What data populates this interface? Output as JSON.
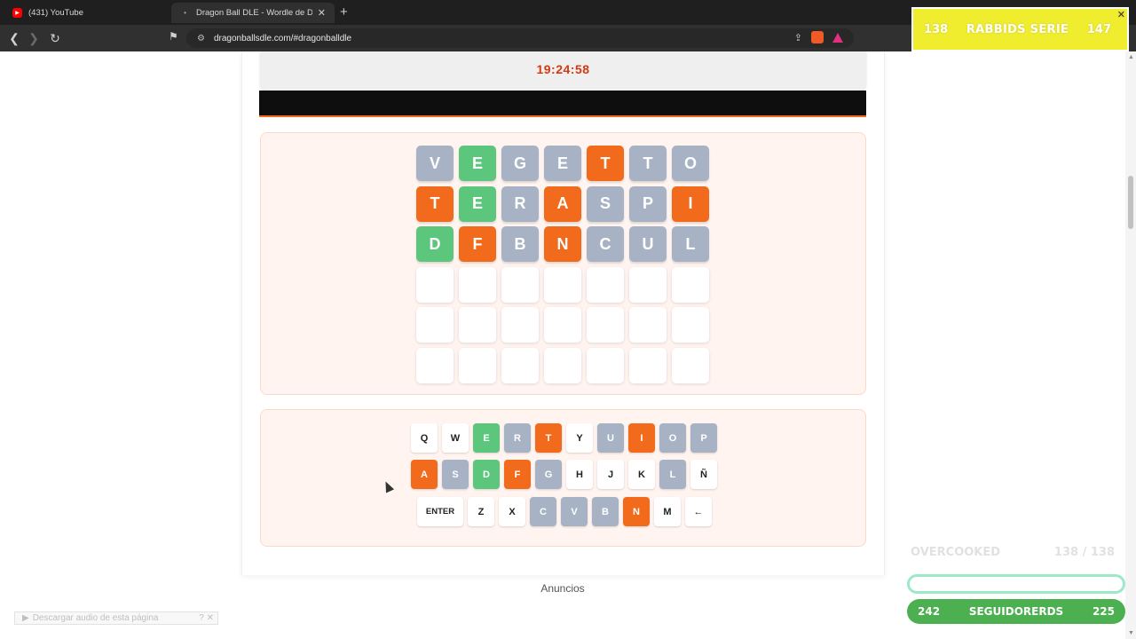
{
  "browser": {
    "tabs": [
      {
        "label": "(431) YouTube",
        "active": false
      },
      {
        "label": "Dragon Ball DLE - Wordle de Dra",
        "active": true
      }
    ],
    "url": "dragonballsdle.com/#dragonballdle"
  },
  "game": {
    "timer": "19:24:58",
    "grid": [
      [
        {
          "l": "V",
          "s": "gray"
        },
        {
          "l": "E",
          "s": "green"
        },
        {
          "l": "G",
          "s": "gray"
        },
        {
          "l": "E",
          "s": "gray"
        },
        {
          "l": "T",
          "s": "orange"
        },
        {
          "l": "T",
          "s": "gray"
        },
        {
          "l": "O",
          "s": "gray"
        }
      ],
      [
        {
          "l": "T",
          "s": "orange"
        },
        {
          "l": "E",
          "s": "green"
        },
        {
          "l": "R",
          "s": "gray"
        },
        {
          "l": "A",
          "s": "orange"
        },
        {
          "l": "S",
          "s": "gray"
        },
        {
          "l": "P",
          "s": "gray"
        },
        {
          "l": "I",
          "s": "orange"
        }
      ],
      [
        {
          "l": "D",
          "s": "green"
        },
        {
          "l": "F",
          "s": "orange"
        },
        {
          "l": "B",
          "s": "gray"
        },
        {
          "l": "N",
          "s": "orange"
        },
        {
          "l": "C",
          "s": "gray"
        },
        {
          "l": "U",
          "s": "gray"
        },
        {
          "l": "L",
          "s": "gray"
        }
      ],
      [
        {
          "l": "",
          "s": "empty"
        },
        {
          "l": "",
          "s": "empty"
        },
        {
          "l": "",
          "s": "empty"
        },
        {
          "l": "",
          "s": "empty"
        },
        {
          "l": "",
          "s": "empty"
        },
        {
          "l": "",
          "s": "empty"
        },
        {
          "l": "",
          "s": "empty"
        }
      ],
      [
        {
          "l": "",
          "s": "empty"
        },
        {
          "l": "",
          "s": "empty"
        },
        {
          "l": "",
          "s": "empty"
        },
        {
          "l": "",
          "s": "empty"
        },
        {
          "l": "",
          "s": "empty"
        },
        {
          "l": "",
          "s": "empty"
        },
        {
          "l": "",
          "s": "empty"
        }
      ],
      [
        {
          "l": "",
          "s": "empty"
        },
        {
          "l": "",
          "s": "empty"
        },
        {
          "l": "",
          "s": "empty"
        },
        {
          "l": "",
          "s": "empty"
        },
        {
          "l": "",
          "s": "empty"
        },
        {
          "l": "",
          "s": "empty"
        },
        {
          "l": "",
          "s": "empty"
        }
      ]
    ],
    "keyboard": [
      [
        {
          "k": "Q",
          "s": "white"
        },
        {
          "k": "W",
          "s": "white"
        },
        {
          "k": "E",
          "s": "green"
        },
        {
          "k": "R",
          "s": "gray"
        },
        {
          "k": "T",
          "s": "orange"
        },
        {
          "k": "Y",
          "s": "white"
        },
        {
          "k": "U",
          "s": "gray"
        },
        {
          "k": "I",
          "s": "orange"
        },
        {
          "k": "O",
          "s": "gray"
        },
        {
          "k": "P",
          "s": "gray"
        }
      ],
      [
        {
          "k": "A",
          "s": "orange"
        },
        {
          "k": "S",
          "s": "gray"
        },
        {
          "k": "D",
          "s": "green"
        },
        {
          "k": "F",
          "s": "orange"
        },
        {
          "k": "G",
          "s": "gray"
        },
        {
          "k": "H",
          "s": "white"
        },
        {
          "k": "J",
          "s": "white"
        },
        {
          "k": "K",
          "s": "white"
        },
        {
          "k": "L",
          "s": "gray"
        },
        {
          "k": "Ñ",
          "s": "white"
        }
      ],
      [
        {
          "k": "ENTER",
          "s": "white"
        },
        {
          "k": "Z",
          "s": "white"
        },
        {
          "k": "X",
          "s": "white"
        },
        {
          "k": "C",
          "s": "gray"
        },
        {
          "k": "V",
          "s": "gray"
        },
        {
          "k": "B",
          "s": "gray"
        },
        {
          "k": "N",
          "s": "orange"
        },
        {
          "k": "M",
          "s": "white"
        },
        {
          "k": "←",
          "s": "white"
        }
      ]
    ],
    "ads_label": "Anuncios"
  },
  "extension": {
    "download_audio": "Descargar audio de esta página"
  },
  "stream_overlay": {
    "top": {
      "left": "138",
      "title": "RABBIDS SERIE",
      "right": "147"
    },
    "goal": {
      "label": "OVERCOOKED",
      "progress": "138 / 138"
    },
    "followers": {
      "left": "242",
      "title": "SEGUIDORERDS",
      "right": "225"
    }
  },
  "colors": {
    "accent_orange": "#f26a1b",
    "correct_green": "#5cc77c",
    "absent_gray": "#a7b3c4",
    "timer_red": "#d43a12"
  }
}
